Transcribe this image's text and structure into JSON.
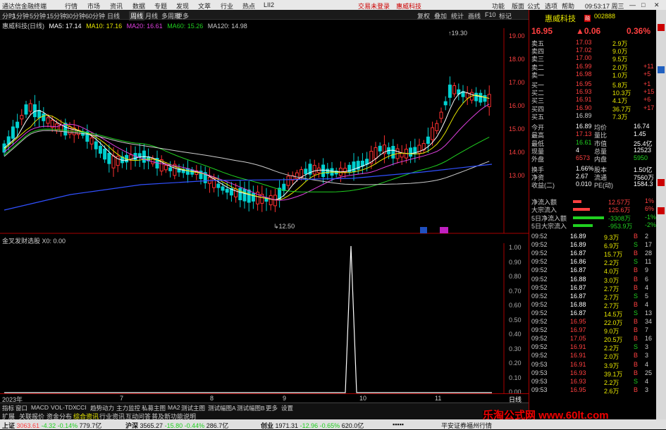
{
  "titlebar": {
    "app": "通达信金融终端",
    "menus": [
      "行情",
      "市场",
      "资讯",
      "数据",
      "专题",
      "发现",
      "文萃",
      "行业",
      "热点",
      "LII2"
    ],
    "center": [
      "交易未登录",
      "惠威科技"
    ],
    "right_menus": [
      "功能",
      "版面",
      "公式",
      "选项",
      "帮助"
    ],
    "time": "09:53:17 周三"
  },
  "periods": [
    "分时",
    "1分钟",
    "5分钟",
    "15分钟",
    "30分钟",
    "60分钟",
    "日线",
    "周线",
    "月线",
    "多周期",
    "更多"
  ],
  "toolbar_right": [
    "复权",
    "叠加",
    "统计",
    "画线",
    "F10",
    "标记"
  ],
  "stock_name": "惠威科技",
  "stock_code": "002888",
  "ma_legend": {
    "name": "惠威科技(日线)",
    "items": [
      {
        "label": "MA5: 17.14",
        "color": "#ffffff"
      },
      {
        "label": "MA10: 17.16",
        "color": "#e8e800"
      },
      {
        "label": "MA20: 16.61",
        "color": "#e040e0"
      },
      {
        "label": "MA60: 15.26",
        "color": "#20d020"
      },
      {
        "label": "MA120: 14.98",
        "color": "#cccccc"
      }
    ]
  },
  "price_axis": [
    "19.00",
    "18.00",
    "17.00",
    "16.00",
    "15.00",
    "14.00",
    "13.00"
  ],
  "candle_high_label": "19.30",
  "candle_low_label": "12.50",
  "indicator": {
    "name": "金叉发财选股",
    "value": "X0: 0.00",
    "axis": [
      "1.00",
      "0.90",
      "0.80",
      "0.70",
      "0.60",
      "0.50",
      "0.40",
      "0.30",
      "0.20",
      "0.10",
      "0.00"
    ]
  },
  "date_axis": [
    "2023年",
    "7",
    "8",
    "9",
    "10",
    "11"
  ],
  "day_tab": "日线",
  "quote": {
    "price": "16.95",
    "change": "▲0.06",
    "pct": "0.36%",
    "asks": [
      [
        "卖五",
        "17.03",
        "2.9万",
        ""
      ],
      [
        "卖四",
        "17.02",
        "9.0万",
        ""
      ],
      [
        "卖三",
        "17.00",
        "9.5万",
        ""
      ],
      [
        "卖二",
        "16.99",
        "2.0万",
        "+11"
      ],
      [
        "卖一",
        "16.98",
        "1.0万",
        "+5"
      ]
    ],
    "bids": [
      [
        "买一",
        "16.95",
        "5.8万",
        "+1"
      ],
      [
        "买二",
        "16.93",
        "10.3万",
        "+15"
      ],
      [
        "买三",
        "16.91",
        "4.1万",
        "+6"
      ],
      [
        "买四",
        "16.90",
        "36.7万",
        "+17"
      ],
      [
        "买五",
        "16.89",
        "7.3万",
        ""
      ]
    ],
    "stats": [
      [
        "今开",
        "16.89",
        "均价",
        "16.74"
      ],
      [
        "最高",
        "17.13",
        "量比",
        "1.45"
      ],
      [
        "最低",
        "16.61",
        "市值",
        "25.4亿"
      ],
      [
        "现量",
        "4",
        "总量",
        "12523"
      ],
      [
        "外盘",
        "6573",
        "内盘",
        "5950"
      ],
      [
        "换手",
        "1.66%",
        "股本",
        "1.50亿"
      ],
      [
        "净资",
        "2.67",
        "流通",
        "7560万"
      ],
      [
        "收益(二)",
        "0.010",
        "PE(动)",
        "1584.3"
      ]
    ],
    "flows": [
      [
        "净流入额",
        "12.57万",
        "1%"
      ],
      [
        "大宗流入",
        "125.6万",
        "6%"
      ],
      [
        "5日净流入额",
        "-3308万",
        "-1%"
      ],
      [
        "5日大宗流入",
        "-953.9万",
        "-2%"
      ]
    ]
  },
  "ticks": [
    [
      "09:52",
      "16.89",
      "9.3万",
      "B",
      "2"
    ],
    [
      "09:52",
      "16.89",
      "6.9万",
      "S",
      "17"
    ],
    [
      "09:52",
      "16.87",
      "15.7万",
      "B",
      "28"
    ],
    [
      "09:52",
      "16.86",
      "2.2万",
      "S",
      "11"
    ],
    [
      "09:52",
      "16.87",
      "4.0万",
      "B",
      "9"
    ],
    [
      "09:52",
      "16.88",
      "3.0万",
      "B",
      "6"
    ],
    [
      "09:52",
      "16.87",
      "2.7万",
      "B",
      "4"
    ],
    [
      "09:52",
      "16.87",
      "2.7万",
      "S",
      "5"
    ],
    [
      "09:52",
      "16.88",
      "2.7万",
      "B",
      "4"
    ],
    [
      "09:52",
      "16.87",
      "14.5万",
      "S",
      "13"
    ],
    [
      "09:52",
      "16.95",
      "22.0万",
      "B",
      "34"
    ],
    [
      "09:52",
      "16.97",
      "9.0万",
      "B",
      "7"
    ],
    [
      "09:52",
      "17.05",
      "20.5万",
      "B",
      "16"
    ],
    [
      "09:52",
      "16.91",
      "2.2万",
      "S",
      "3"
    ],
    [
      "09:52",
      "16.91",
      "2.0万",
      "B",
      "3"
    ],
    [
      "09:53",
      "16.91",
      "3.9万",
      "B",
      "4"
    ],
    [
      "09:53",
      "16.93",
      "39.1万",
      "B",
      "25"
    ],
    [
      "09:53",
      "16.93",
      "2.2万",
      "S",
      "4"
    ],
    [
      "09:53",
      "16.95",
      "2.6万",
      "B",
      "3"
    ]
  ],
  "bottom_tabs": [
    "指标",
    "窗口",
    "MACD",
    "VOL-TDX",
    "CCI",
    "趋势动力",
    "主力监控",
    "私募主图",
    "MA2",
    "测试主图",
    "测试幅图A",
    "测试幅图B",
    "更多",
    "设置"
  ],
  "left_tabs": [
    "扩展",
    "关联报价",
    "资金分布",
    "综合资讯",
    "行业资讯",
    "互动问答",
    "普及新功能说明"
  ],
  "status": {
    "items": [
      {
        "name": "上证",
        "v": "3063.61",
        "c": "-4.32",
        "p": "-0.14%",
        "a": "779.7亿"
      },
      {
        "name": "沪深",
        "v": "3565.27",
        "c": "-15.80",
        "p": "-0.44%",
        "a": "286.7亿"
      },
      {
        "name": "创业",
        "v": "1971.31",
        "c": "-12.96",
        "p": "-0.65%",
        "a": "620.0亿"
      }
    ],
    "broker": "平安证券福州行情"
  },
  "brand": "乐淘公式网 www.60lt.com",
  "indicator_chart": {
    "type": "line",
    "series": [
      {
        "values": [
          0,
          0,
          0,
          0,
          0,
          0,
          0,
          0,
          0,
          0,
          0,
          0,
          0,
          0,
          0,
          0,
          1,
          0,
          0,
          0,
          0,
          0,
          0,
          0
        ]
      }
    ],
    "ylim": [
      0,
      1
    ]
  }
}
